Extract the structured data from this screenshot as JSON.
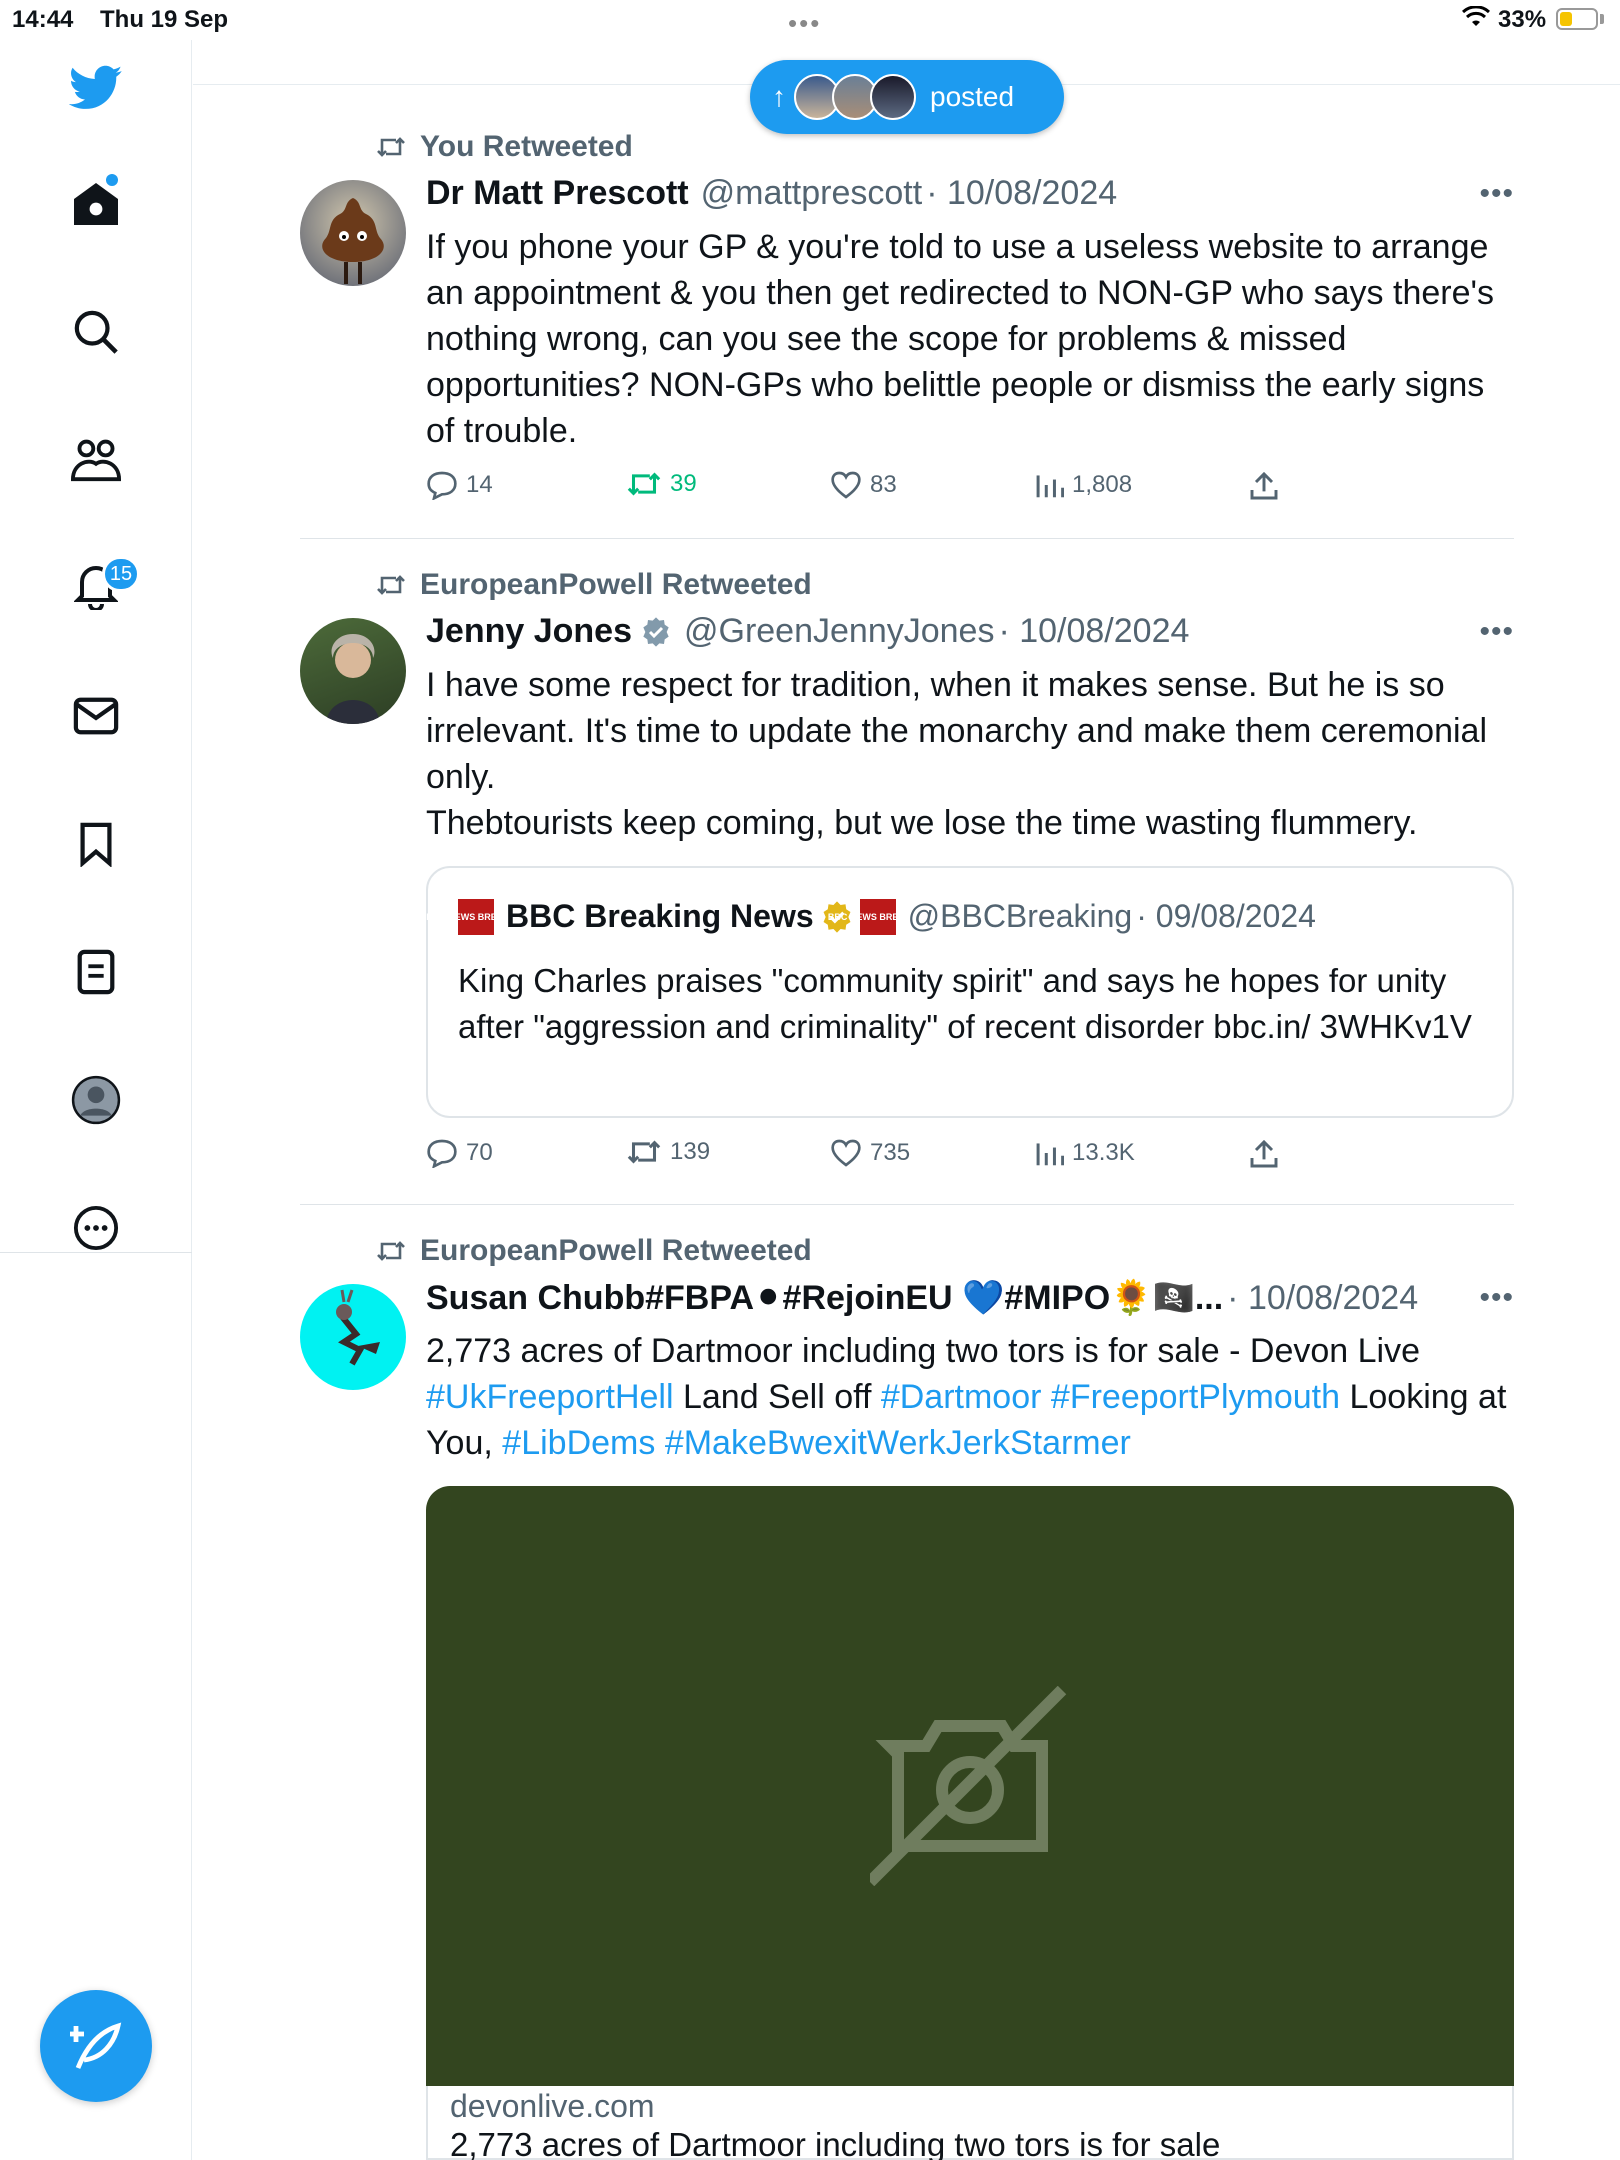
{
  "status_bar": {
    "time": "14:44",
    "date": "Thu 19 Sep",
    "battery": "33%"
  },
  "nav": {
    "notifications_badge": "15",
    "items": [
      "home-icon",
      "search-icon",
      "communities-icon",
      "notifications-icon",
      "messages-icon",
      "bookmarks-icon",
      "lists-icon",
      "profile-icon",
      "more-icon"
    ]
  },
  "new_posts_pill": {
    "label": "posted"
  },
  "tweets": [
    {
      "retweet_line": "You Retweeted",
      "name": "Dr Matt Prescott",
      "handle": "@mattprescott",
      "date": "· 10/08/2024",
      "text": "If you phone your GP & you're told to use a useless website to arrange an appointment & you then get redirected to NON-GP who says there's nothing wrong, can you see the scope for problems & missed opportunities? NON-GPs who belittle people or dismiss the early signs of trouble.",
      "replies": "14",
      "retweets": "39",
      "likes": "83",
      "views": "1,808"
    },
    {
      "retweet_line": "EuropeanPowell Retweeted",
      "name": "Jenny Jones",
      "handle": "@GreenJennyJones",
      "date": "· 10/08/2024",
      "text_line1": "I have some respect for tradition, when it makes sense. But he is so irrelevant. It's time to update the monarchy and make them ceremonial only.",
      "text_line2": "Thebtourists keep coming, but we lose the time wasting flummery.",
      "quote": {
        "logo_text": "BBC NEWS BREAKING",
        "name": "BBC Breaking News",
        "handle": "@BBCBreaking",
        "date": "· 09/08/2024",
        "text": "King Charles praises \"community spirit\" and says he hopes for unity after \"aggression and criminality\" of recent disorder bbc.in/ 3WHKv1V"
      },
      "replies": "70",
      "retweets": "139",
      "likes": "735",
      "views": "13.3K"
    },
    {
      "retweet_line": "EuropeanPowell Retweeted",
      "name": "Susan Chubb#FBPA⚫#RejoinEU 💙#MIPO🌻🏴‍☠️...",
      "handle": "",
      "date": "· 10/08/2024",
      "text_plain1": "2,773 acres of Dartmoor including two tors is for sale - Devon Live",
      "tag1": "#UkFreeportHell",
      "text_plain2": " Land Sell off ",
      "tag2": "#Dartmoor",
      "tag3": "#FreeportPlymouth",
      "text_plain3": " Looking at You, ",
      "tag4": "#LibDems",
      "tag5": "#MakeBwexitWerkJerkStarmer",
      "card": {
        "domain": "devonlive.com",
        "title": "2,773 acres of Dartmoor including two tors is for sale"
      }
    }
  ],
  "colors": {
    "accent": "#1d9bf0",
    "retweet_green": "#00ba7c",
    "media_bg": "#33451f"
  }
}
